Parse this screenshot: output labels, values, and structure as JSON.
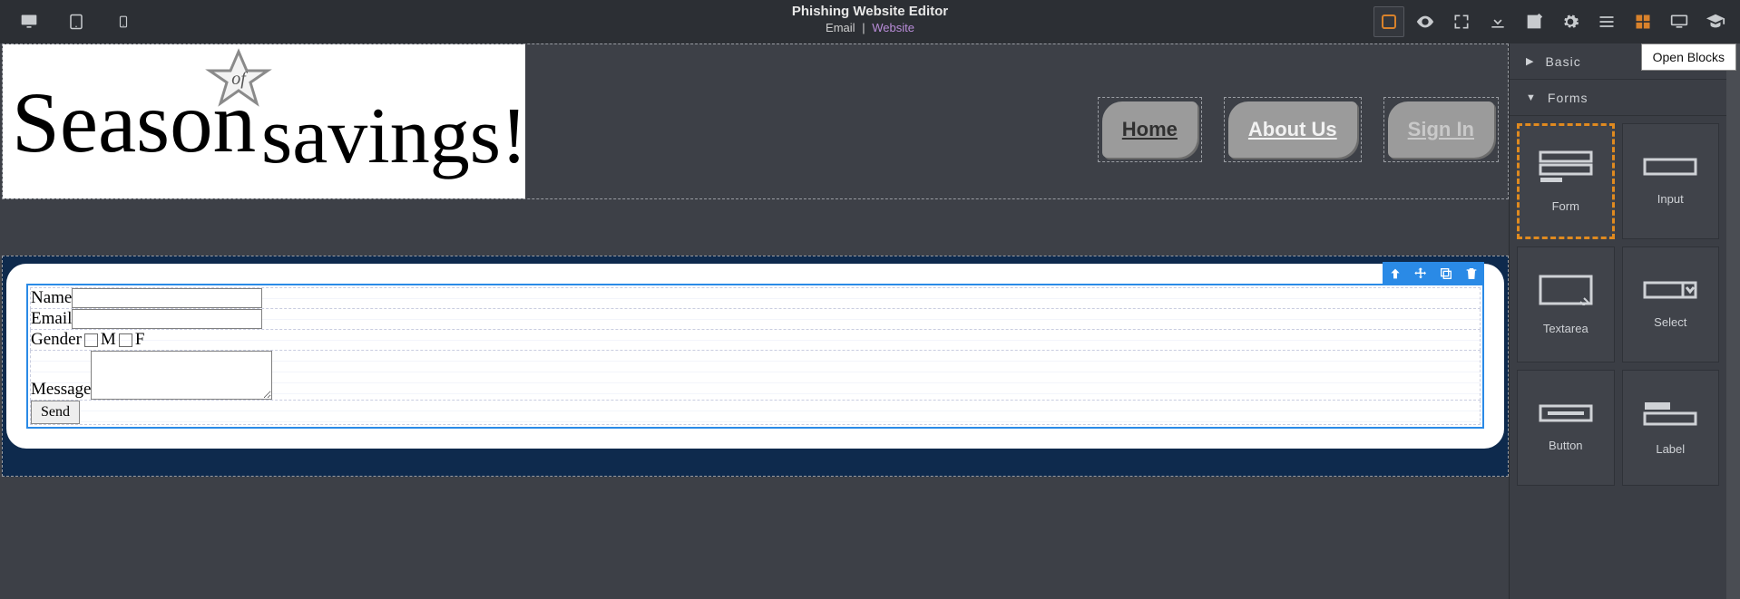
{
  "header": {
    "title": "Phishing Website Editor",
    "sub_email": "Email",
    "sub_pipe": "|",
    "sub_website": "Website"
  },
  "tooltip": "Open Blocks",
  "banner": {
    "text_line1": "Season",
    "text_of": "of",
    "text_line2": "savings!"
  },
  "nav": {
    "items": [
      {
        "label": "Home"
      },
      {
        "label": "About Us"
      },
      {
        "label": "Sign In"
      }
    ]
  },
  "form": {
    "fields": {
      "name_label": "Name",
      "email_label": "Email",
      "gender_label": "Gender",
      "gender_m": "M",
      "gender_f": "F",
      "message_label": "Message",
      "send_label": "Send"
    }
  },
  "panel": {
    "section_basic": "Basic",
    "section_forms": "Forms",
    "blocks": [
      {
        "label": "Form"
      },
      {
        "label": "Input"
      },
      {
        "label": "Textarea"
      },
      {
        "label": "Select"
      },
      {
        "label": "Button"
      },
      {
        "label": "Label"
      }
    ]
  }
}
